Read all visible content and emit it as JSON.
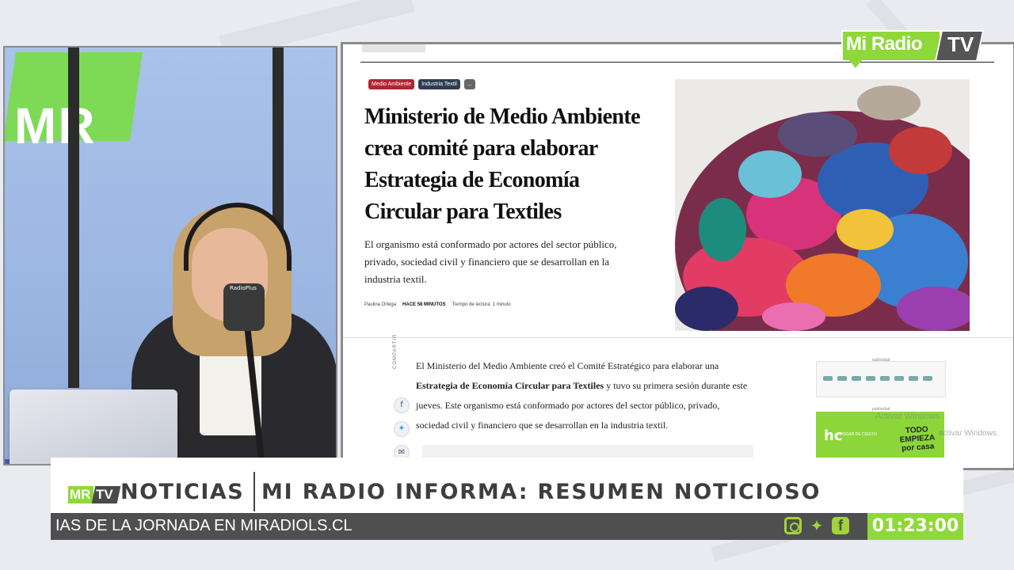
{
  "broadcast": {
    "logo_text": "Mi Radio",
    "logo_tv": "TV"
  },
  "studio": {
    "wall_logo": "MR",
    "mic_brand": "RadioPlus"
  },
  "article": {
    "tags": [
      "Medio Ambiente",
      "Industria Textil",
      "..."
    ],
    "title": "Ministerio de Medio Ambiente crea comité para elaborar Estrategia de Economía Circular para Textiles",
    "lede": "El organismo está conformado por actores del sector público, privado, sociedad civil y financiero que se desarrollan en la industria textil.",
    "author": "Paulina Ortega",
    "published": "HACE 58 MINUTOS",
    "reading_time": "Tiempo de lectura: 1 minuto",
    "share_label": "COMPARTIR",
    "share_icons": [
      "facebook-icon",
      "twitter-icon",
      "mail-icon"
    ],
    "body_before": "El Ministerio del Medio Ambiente creó el Comité Estratégico para elaborar una ",
    "body_bold": "Estrategia de Economía Circular para Textiles",
    "body_after": " y tuvo su primera sesión durante este jueves. Este organismo está conformado por actores del sector público, privado, sociedad civil y financiero que se desarrollan en la industria textil.",
    "ad_label": "publicidad",
    "ad2_brand": "HOGAR DE CRISTO",
    "ad2_slogan": "TODO EMPIEZA por casa"
  },
  "watermark": {
    "line1": "Activar Windows",
    "line2": "activar Windows."
  },
  "lower_third": {
    "logo_mr": "MR",
    "logo_tv": "TV",
    "section": "NOTICIAS",
    "headline": "MI RADIO INFORMA: RESUMEN NOTICIOSO",
    "ticker": "IAS DE LA JORNADA EN MIRADIOLS.CL",
    "clock": "01:23:00"
  },
  "colors": {
    "brand_green": "#8fd839",
    "dark_gray": "#4f4f4f"
  }
}
